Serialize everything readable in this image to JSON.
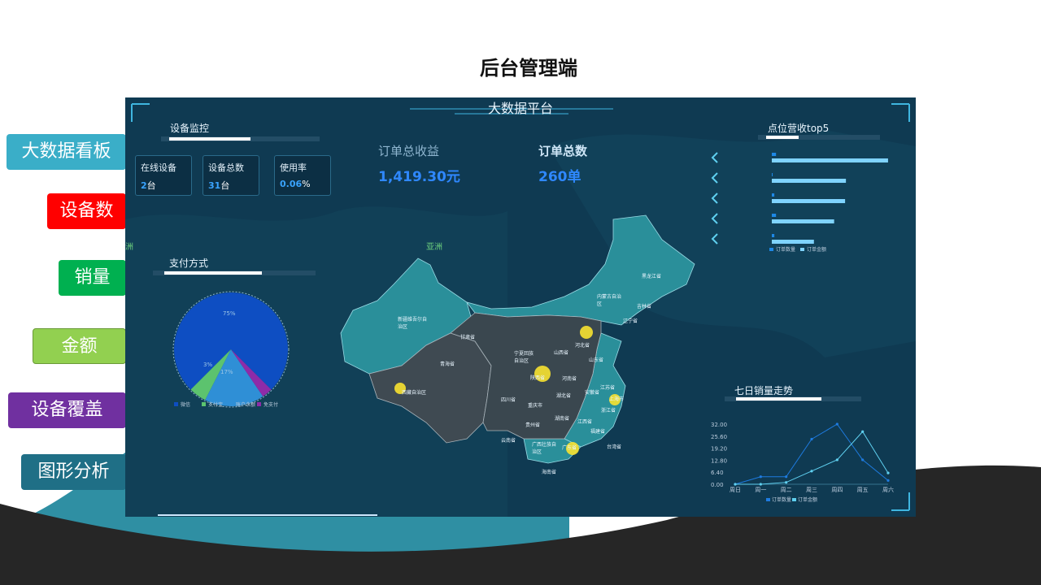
{
  "slide": {
    "title": "后台管理端"
  },
  "sidebar": {
    "items": [
      {
        "label": "大数据看板",
        "color": "#3aaec8"
      },
      {
        "label": "设备数",
        "color": "#ff0000"
      },
      {
        "label": "销量",
        "color": "#00b050"
      },
      {
        "label": "金额",
        "color": "#92d050"
      },
      {
        "label": "设备覆盖",
        "color": "#7030a0"
      },
      {
        "label": "图形分析",
        "color": "#1f6f86"
      }
    ]
  },
  "dashboard": {
    "title": "大数据平台",
    "device_monitor": {
      "title": "设备监控",
      "cards": [
        {
          "label": "在线设备",
          "value": "2",
          "unit": "台"
        },
        {
          "label": "设备总数",
          "value": "31",
          "unit": "台"
        },
        {
          "label": "使用率",
          "value": "0.06",
          "unit": "%"
        }
      ]
    },
    "order_revenue": {
      "label": "订单总收益",
      "value": "1,419.30元"
    },
    "order_total": {
      "label": "订单总数",
      "value": "260单"
    },
    "map_labels": {
      "asia": "亚洲",
      "left_edge": "洲"
    },
    "provinces": [
      "新疆维吾尔自治区",
      "西藏自治区",
      "青海省",
      "甘肃省",
      "四川省",
      "云南省",
      "宁夏回族自治区",
      "陕西省",
      "山西省",
      "河北省",
      "内蒙古自治区",
      "黑龙江省",
      "吉林省",
      "辽宁省",
      "山东省",
      "河南省",
      "湖北省",
      "安徽省",
      "江苏省",
      "上海市",
      "浙江省",
      "江西省",
      "湖南省",
      "贵州省",
      "重庆市",
      "广西壮族自治区",
      "广东省",
      "福建省",
      "台湾省",
      "海南省"
    ],
    "pie": {
      "title": "支付方式",
      "legend": [
        "微信",
        "支付宝",
        "账户余额",
        "免支付"
      ],
      "labels": [
        "75%",
        "17%",
        "3%"
      ]
    },
    "top5": {
      "title": "点位营收top5",
      "legend": [
        "订单数量",
        "订单金额"
      ]
    },
    "line": {
      "title": "七日销量走势",
      "legend": [
        "订单数量",
        "订单金额"
      ]
    }
  },
  "colors": {
    "panel": "#0f3a52",
    "accent": "#3aa4ff",
    "map_teal": "#2a8f9a",
    "map_grey": "#3f4a52"
  },
  "chart_data": [
    {
      "type": "pie",
      "title": "支付方式",
      "categories": [
        "微信",
        "支付宝",
        "账户余额",
        "免支付"
      ],
      "values": [
        75,
        5,
        17,
        3
      ],
      "colors": [
        "#0e4ec2",
        "#5cc36e",
        "#2f8fd6",
        "#8e2ba8"
      ],
      "legend": "bottom"
    },
    {
      "type": "bar",
      "title": "点位营收top5",
      "categories": [
        "1",
        "2",
        "3",
        "4",
        "5"
      ],
      "series": [
        {
          "name": "订单数量",
          "values": [
            5,
            1,
            3,
            5,
            3
          ],
          "color": "#1e88e5"
        },
        {
          "name": "订单金额",
          "values": [
            138,
            88,
            87,
            74,
            50
          ],
          "color": "#7fd3ff"
        }
      ],
      "xlim": [
        0,
        140
      ],
      "legend": "bottom"
    },
    {
      "type": "line",
      "title": "七日销量走势",
      "categories": [
        "周日",
        "周一",
        "周二",
        "周三",
        "周四",
        "周五",
        "周六"
      ],
      "y_ticks": [
        "0.00",
        "6.40",
        "12.80",
        "19.20",
        "25.60",
        "32.00"
      ],
      "ylim": [
        0,
        32
      ],
      "series": [
        {
          "name": "订单数量",
          "values": [
            0,
            4,
            4,
            24,
            32,
            13,
            2
          ],
          "color": "#1e7be0"
        },
        {
          "name": "订单金额",
          "values": [
            0,
            0,
            1,
            7,
            13,
            28,
            6
          ],
          "color": "#5fd0f0"
        }
      ],
      "legend": "bottom"
    }
  ]
}
